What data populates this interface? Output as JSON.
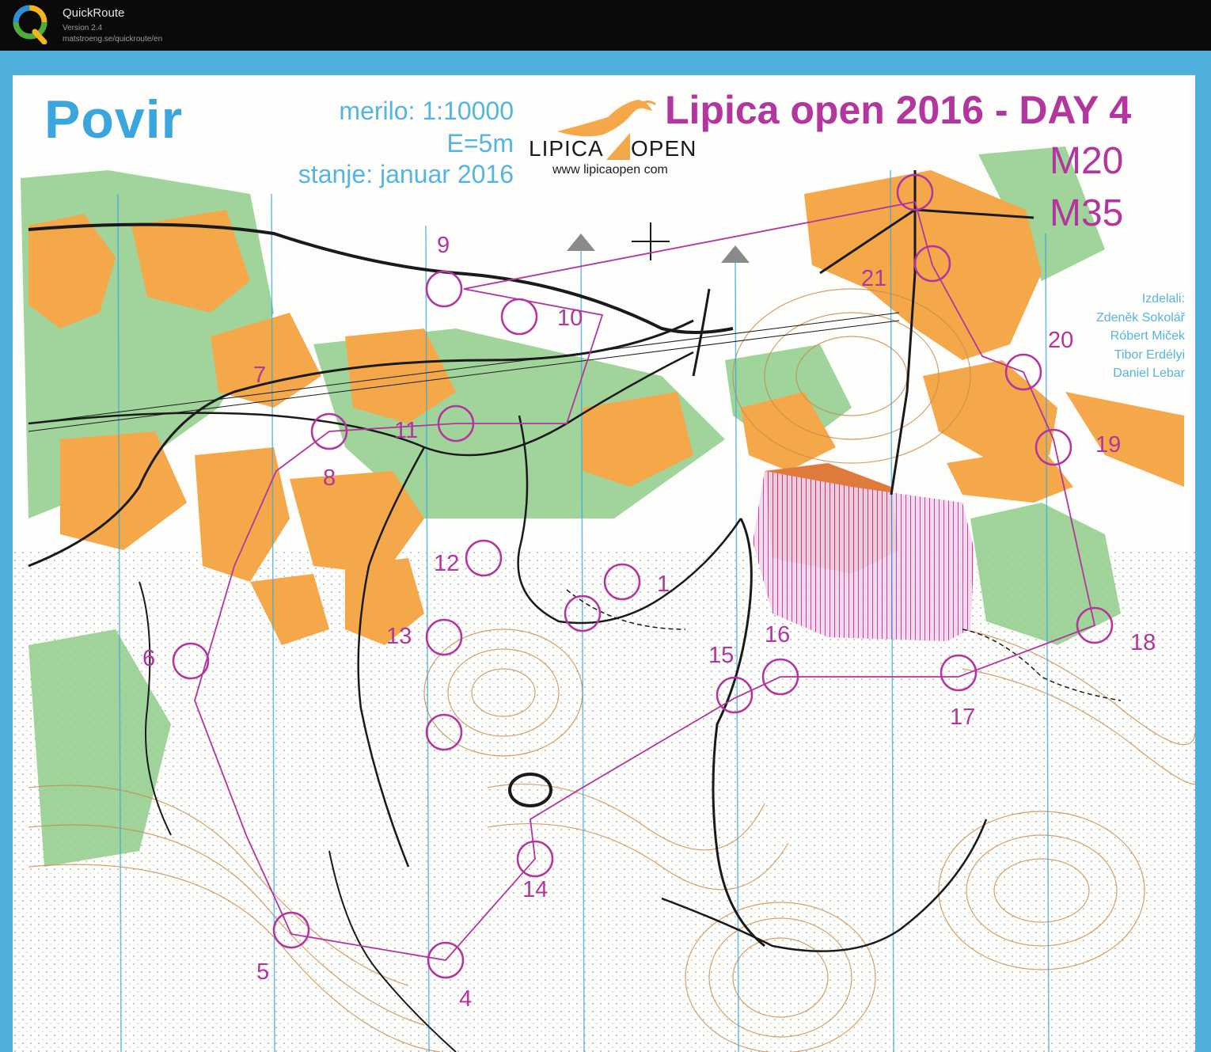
{
  "app": {
    "title": "QuickRoute",
    "version": "Version 2.4",
    "url": "matstroeng.se/quickroute/en"
  },
  "map": {
    "name": "Povir",
    "scale": "merilo: 1:10000",
    "contour_interval": "E=5m",
    "revision": "stanje: januar 2016",
    "event_title": "Lipica open 2016 - DAY 4",
    "classes": [
      "M20",
      "M35"
    ],
    "logo": {
      "word_left": "LIPICA",
      "word_right": "OPEN",
      "website": "www lipicaopen com"
    },
    "credits": {
      "heading": "Izdelali:",
      "names": [
        "Zdeněk Sokolář",
        "Róbert Miček",
        "Tibor Erdélyi",
        "Daniel Lebar"
      ]
    },
    "controls": [
      "1",
      "4",
      "5",
      "6",
      "7",
      "8",
      "9",
      "10",
      "11",
      "12",
      "13",
      "14",
      "15",
      "16",
      "17",
      "18",
      "19",
      "20",
      "21"
    ]
  },
  "colors": {
    "app_bar": "#0a0a0a",
    "background": "#4fb0de",
    "paper": "#fdfdfb",
    "course": "#b3359e",
    "open_land": "#f4a84a",
    "forest_green": "#7cc47a",
    "contour": "#c98a4e",
    "title_blue": "#3aa6dd"
  }
}
